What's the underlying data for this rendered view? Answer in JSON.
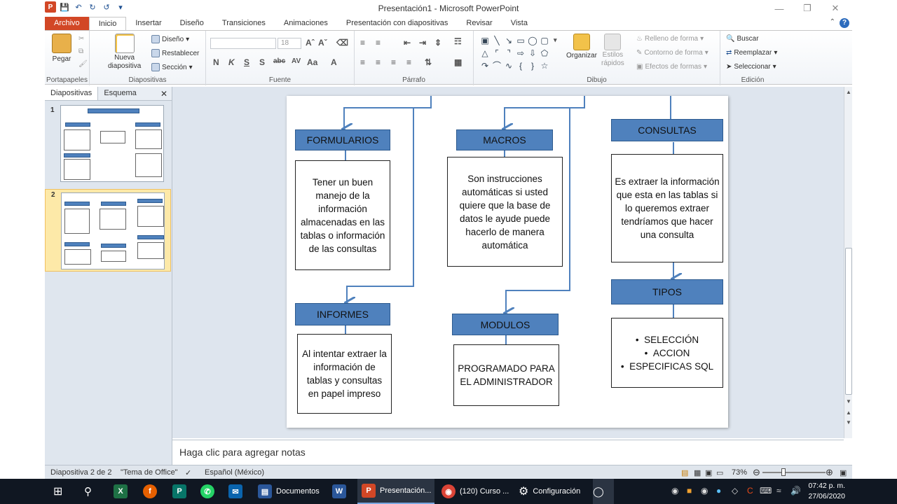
{
  "window": {
    "title": "Presentación1 - Microsoft PowerPoint",
    "minimize_icon": "minimize-icon",
    "maximize_icon": "restore-icon",
    "close_icon": "close-icon"
  },
  "ribbon_tabs": [
    "Archivo",
    "Inicio",
    "Insertar",
    "Diseño",
    "Transiciones",
    "Animaciones",
    "Presentación con diapositivas",
    "Revisar",
    "Vista"
  ],
  "active_tab": "Inicio",
  "ribbon": {
    "portapapeles": {
      "label": "Portapapeles",
      "paste": "Pegar"
    },
    "diapositivas": {
      "label": "Diapositivas",
      "new_slide_1": "Nueva",
      "new_slide_2": "diapositiva",
      "layout": "Diseño",
      "reset": "Restablecer",
      "section": "Sección"
    },
    "fuente": {
      "label": "Fuente",
      "font_size": "18"
    },
    "parrafo": {
      "label": "Párrafo"
    },
    "dibujo": {
      "label": "Dibujo",
      "arrange": "Organizar",
      "quick_styles_1": "Estilos",
      "quick_styles_2": "rápidos",
      "fill": "Relleno de forma",
      "outline": "Contorno de forma",
      "effects": "Efectos de formas"
    },
    "edicion": {
      "label": "Edición",
      "find": "Buscar",
      "replace": "Reemplazar",
      "select": "Seleccionar"
    }
  },
  "left_pane": {
    "tab_slides": "Diapositivas",
    "tab_outline": "Esquema",
    "thumbnails": [
      {
        "number": "1"
      },
      {
        "number": "2"
      }
    ]
  },
  "slide": {
    "formularios": {
      "title": "FORMULARIOS",
      "body": "Tener un buen manejo de la información almacenadas en las tablas o información de las consultas"
    },
    "macros": {
      "title": "MACROS",
      "body": "Son instrucciones automáticas si usted quiere que la base de datos le ayude puede hacerlo de manera automática"
    },
    "consultas": {
      "title": "CONSULTAS",
      "body": "Es  extraer la información que esta en las tablas si lo queremos extraer tendríamos que hacer una consulta"
    },
    "informes": {
      "title": "INFORMES",
      "body": "Al intentar extraer la información de tablas y consultas en papel impreso"
    },
    "modulos": {
      "title": "MODULOS",
      "body": "PROGRAMADO PARA EL ADMINISTRADOR"
    },
    "tipos": {
      "title": "TIPOS",
      "items": [
        "SELECCIÓN",
        "ACCION",
        "ESPECIFICAS SQL"
      ]
    }
  },
  "notes_placeholder": "Haga clic para agregar notas",
  "status": {
    "slide_of": "Diapositiva 2 de 2",
    "theme": "\"Tema de Office\"",
    "language": "Español (México)",
    "zoom": "73%"
  },
  "taskbar": {
    "items": [
      "Documentos",
      "Presentación...",
      "(120) Curso ...",
      "Configuración"
    ],
    "time": "07:42 p. m.",
    "date": "27/06/2020"
  }
}
